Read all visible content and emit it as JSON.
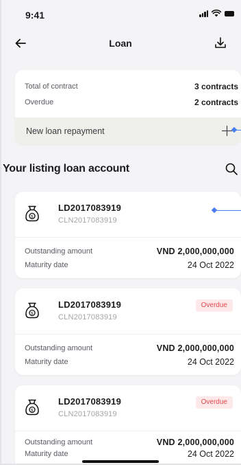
{
  "status_bar": {
    "time": "9:41"
  },
  "header": {
    "title": "Loan"
  },
  "summary": {
    "total_label": "Total of contract",
    "total_value": "3 contracts",
    "overdue_label": "Overdue",
    "overdue_value": "2 contracts",
    "repay_label": "New loan repayment"
  },
  "section": {
    "title": "Your listing loan account"
  },
  "icons": {
    "back": "arrow-left-icon",
    "download": "download-icon",
    "plus": "plus-icon",
    "search": "search-icon",
    "loan": "money-bag-icon"
  },
  "colors": {
    "accent": "#4a7ef0",
    "overdue_bg": "#fde9e9",
    "overdue_text": "#e8484b"
  },
  "loans": [
    {
      "id": "LD2017083919",
      "cln": "CLN2017083919",
      "badge": "",
      "outstanding_label": "Outstanding amount",
      "outstanding_value": "VND 2,000,000,000",
      "maturity_label": "Maturity date",
      "maturity_value": "24 Oct 2022"
    },
    {
      "id": "LD2017083919",
      "cln": "CLN2017083919",
      "badge": "Overdue",
      "outstanding_label": "Outstanding amount",
      "outstanding_value": "VND 2,000,000,000",
      "maturity_label": "Maturity date",
      "maturity_value": "24 Oct 2022"
    },
    {
      "id": "LD2017083919",
      "cln": "CLN2017083919",
      "badge": "Overdue",
      "outstanding_label": "Outstanding amount",
      "outstanding_value": "VND 2,000,000,000",
      "maturity_label": "Maturity date",
      "maturity_value": "24 Oct 2022"
    }
  ]
}
